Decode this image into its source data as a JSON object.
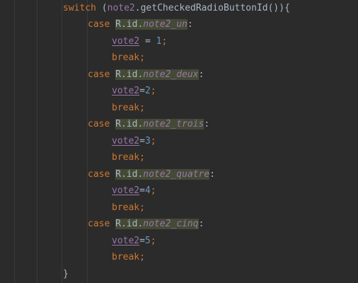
{
  "code": {
    "switch_line": {
      "keyword": "switch",
      "open": "(",
      "var": "note2",
      "call": ".getCheckedRadioButtonId()){"
    },
    "cases": [
      {
        "case_kw": "case",
        "ref_prefix": "R.id.",
        "ref_name": "note2_un",
        "colon": ":",
        "assign_var": "vote2",
        "assign_op": " = ",
        "value": "1",
        "semicolon": ";",
        "break_kw": "break",
        "break_semi": ";"
      },
      {
        "case_kw": "case",
        "ref_prefix": "R.id.",
        "ref_name": "note2_deux",
        "colon": ":",
        "assign_var": "vote2",
        "assign_op": "=",
        "value": "2",
        "semicolon": ";",
        "break_kw": "break",
        "break_semi": ";"
      },
      {
        "case_kw": "case",
        "ref_prefix": "R.id.",
        "ref_name": "note2_trois",
        "colon": ":",
        "assign_var": "vote2",
        "assign_op": "=",
        "value": "3",
        "semicolon": ";",
        "break_kw": "break",
        "break_semi": ";"
      },
      {
        "case_kw": "case",
        "ref_prefix": "R.id.",
        "ref_name": "note2_quatre",
        "colon": ":",
        "assign_var": "vote2",
        "assign_op": "=",
        "value": "4",
        "semicolon": ";",
        "break_kw": "break",
        "break_semi": ";"
      },
      {
        "case_kw": "case",
        "ref_prefix": "R.id.",
        "ref_name": "note2_cinq",
        "colon": ":",
        "assign_var": "vote2",
        "assign_op": "=",
        "value": "5",
        "semicolon": ";",
        "break_kw": "break",
        "break_semi": ";"
      }
    ],
    "closing_brace": "}"
  },
  "colors": {
    "background": "#2b2b2b",
    "keyword": "#cc7832",
    "field": "#9876aa",
    "number": "#6897bb",
    "plain": "#a9b7c6",
    "highlight": "#444a35"
  }
}
